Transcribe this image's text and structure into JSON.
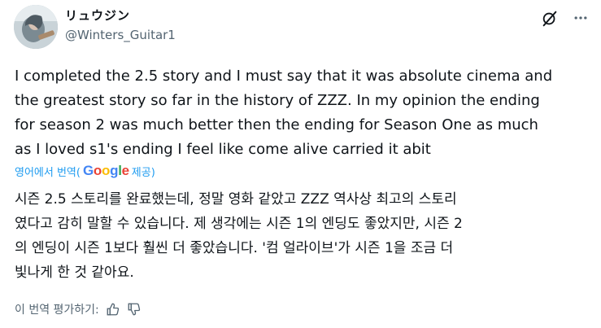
{
  "post": {
    "author": {
      "display_name": "リュウジン",
      "handle": "@Winters_Guitar1"
    },
    "icons": {
      "grok": "grok-icon",
      "more": "more-icon"
    },
    "text": "I completed the 2.5 story and I must say that it was absolute cinema and\nthe greatest story so far in the history of ZZZ. In my opinion the ending\nfor season 2 was much better then the ending for Season One as much\nas I loved s1's ending I feel like come alive carried it abit",
    "translation": {
      "label_before": "영어에서 번역(",
      "provider_letters": [
        "G",
        "o",
        "o",
        "g",
        "l",
        "e"
      ],
      "provider_colors": [
        "#4285F4",
        "#EA4335",
        "#FBBC05",
        "#4285F4",
        "#34A853",
        "#EA4335"
      ],
      "label_after": " 제공)",
      "text": "시즌 2.5 스토리를 완료했는데, 정말 영화 같았고 ZZZ 역사상 최고의 스토리\n였다고 감히 말할 수 있습니다. 제 생각에는 시즌 1의 엔딩도 좋았지만, 시즌 2\n의 엔딩이 시즌 1보다 훨씬 더 좋았습니다. '컴 얼라이브'가 시즌 1을 조금 더\n빛나게 한 것 같아요."
    },
    "rate": {
      "label": "이 번역 평가하기:",
      "like_icon": "thumbs-up-icon",
      "dislike_icon": "thumbs-down-icon"
    }
  }
}
